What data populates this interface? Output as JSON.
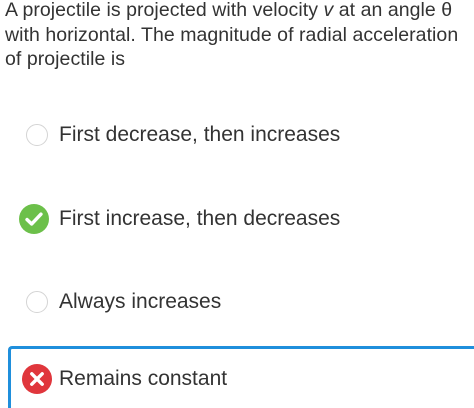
{
  "question": {
    "line1_prefix": "A projectile is projected with velocity ",
    "line1_var": "v",
    "line1_suffix": " at an angle θ",
    "line2": "with horizontal. The magnitude of radial acceleration",
    "line3": "of projectile is"
  },
  "options": [
    {
      "label": "First decrease, then increases",
      "state": "unselected",
      "icon": "radio-empty-icon"
    },
    {
      "label": "First increase, then decreases",
      "state": "correct",
      "icon": "check-circle-icon",
      "color": "#6cc04a"
    },
    {
      "label": "Always increases",
      "state": "unselected",
      "icon": "radio-empty-icon"
    },
    {
      "label": "Remains constant",
      "state": "incorrect",
      "icon": "x-circle-icon",
      "color": "#e0363c"
    }
  ],
  "colors": {
    "text": "#333333",
    "correct": "#6cc04a",
    "incorrect": "#e0363c",
    "selection_border": "#1f8fdc",
    "radio_border": "#d4d4d4"
  }
}
